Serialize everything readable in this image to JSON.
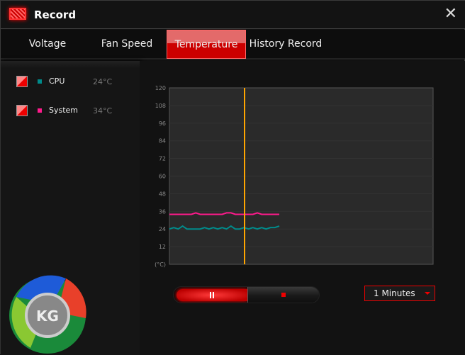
{
  "window": {
    "title": "Record",
    "close_icon": "close-icon"
  },
  "tabs": [
    {
      "label": "Voltage"
    },
    {
      "label": "Fan Speed"
    },
    {
      "label": "Temperature",
      "active": true
    },
    {
      "label": "History Record"
    }
  ],
  "legend": [
    {
      "label": "CPU",
      "value": "24°C",
      "color": "#008b8b",
      "checked": true
    },
    {
      "label": "System",
      "value": "34°C",
      "color": "#ff1a8c",
      "checked": true
    }
  ],
  "controls": {
    "pause_icon": "pause-icon",
    "stop_icon": "stop-icon",
    "interval": "1 Minutes"
  },
  "logo": {
    "text": "KG"
  },
  "chart_data": {
    "type": "line",
    "ylabel": "(°C)",
    "ylim": [
      0,
      120
    ],
    "yticks": [
      "12",
      "24",
      "36",
      "48",
      "60",
      "72",
      "84",
      "96",
      "108",
      "120"
    ],
    "grid": true,
    "cursor_color": "#ffa500",
    "series": [
      {
        "name": "CPU",
        "color": "#008b8b",
        "values": [
          24,
          25,
          24,
          26,
          24,
          24,
          24,
          24,
          25,
          24,
          25,
          24,
          25,
          24,
          26,
          24,
          24,
          25,
          24,
          25,
          24,
          25,
          24,
          25,
          25,
          26
        ]
      },
      {
        "name": "System",
        "color": "#ff1a8c",
        "values": [
          34,
          34,
          34,
          34,
          34,
          34,
          35,
          34,
          34,
          34,
          34,
          34,
          34,
          35,
          35,
          34,
          34,
          34,
          34,
          34,
          35,
          34,
          34,
          34,
          34,
          34
        ]
      }
    ]
  }
}
